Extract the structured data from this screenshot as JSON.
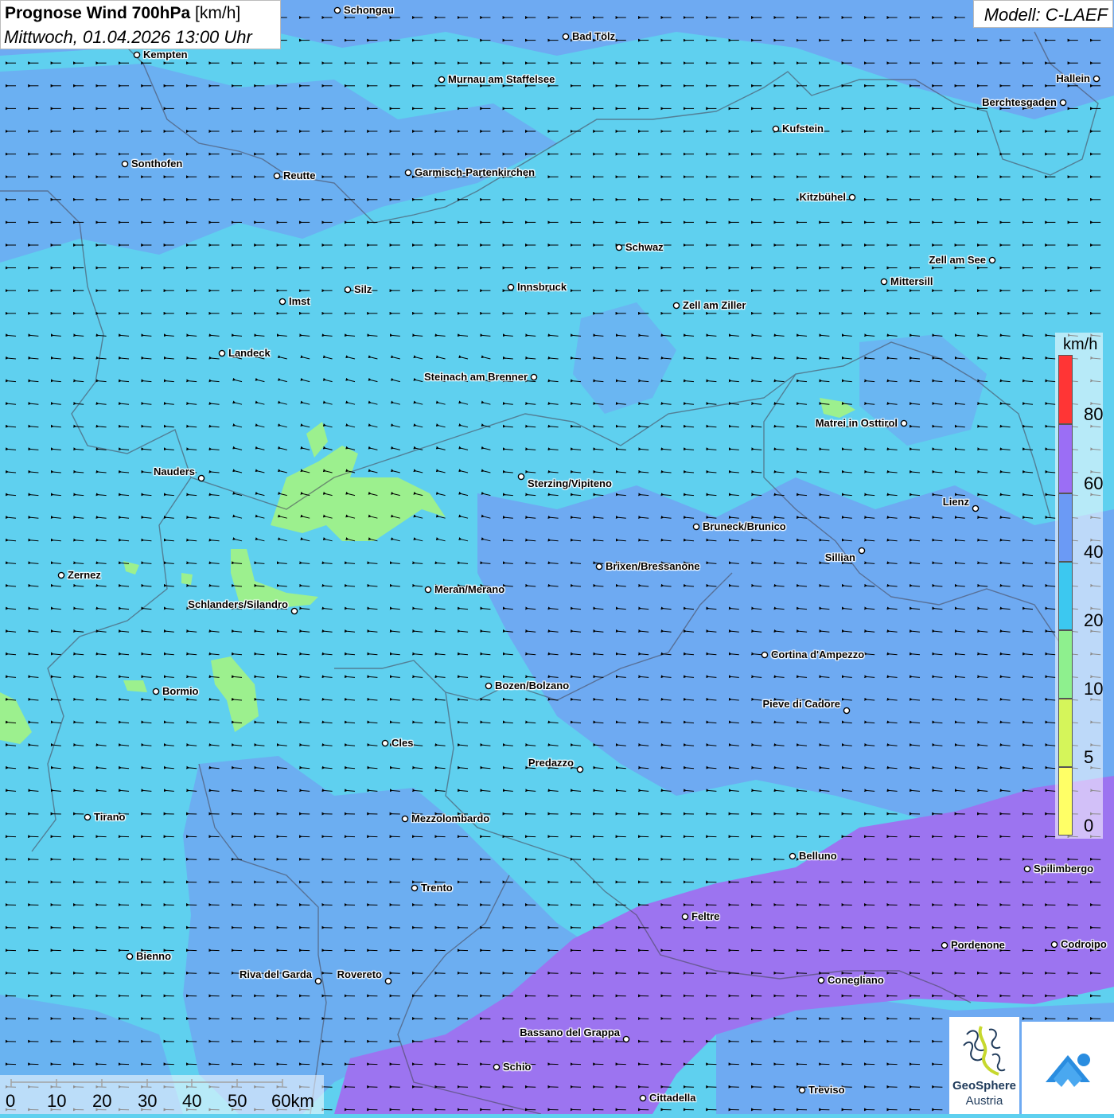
{
  "title": {
    "main": "Prognose Wind 700hPa",
    "unit": "[km/h]",
    "datetime": "Mittwoch, 01.04.2026 13:00 Uhr"
  },
  "model": "Modell: C-LAEF",
  "legend": {
    "unit": "km/h",
    "labels": [
      "80",
      "60",
      "40",
      "20",
      "10",
      "5",
      "0"
    ],
    "colors": [
      "#ff3535",
      "#9b6ef5",
      "#6b9af5",
      "#3cc8f0",
      "#8ef08e",
      "#d5f55a",
      "#ffff66"
    ]
  },
  "scalebar": {
    "labels": [
      "0",
      "10",
      "20",
      "30",
      "40",
      "50",
      "60km"
    ]
  },
  "cities": [
    {
      "name": "Schongau"
    },
    {
      "name": "Bad Tölz"
    },
    {
      "name": "Kempten"
    },
    {
      "name": "Murnau am Staffelsee"
    },
    {
      "name": "Hallein"
    },
    {
      "name": "Berchtesgaden"
    },
    {
      "name": "Kufstein"
    },
    {
      "name": "Sonthofen"
    },
    {
      "name": "Reutte"
    },
    {
      "name": "Garmisch-Partenkirchen"
    },
    {
      "name": "Kitzbühel"
    },
    {
      "name": "Schwaz"
    },
    {
      "name": "Zell am See"
    },
    {
      "name": "Mittersill"
    },
    {
      "name": "Silz"
    },
    {
      "name": "Innsbruck"
    },
    {
      "name": "Imst"
    },
    {
      "name": "Zell am Ziller"
    },
    {
      "name": "Landeck"
    },
    {
      "name": "Steinach am Brenner"
    },
    {
      "name": "Matrei in Osttirol"
    },
    {
      "name": "Nauders"
    },
    {
      "name": "Sterzing/Vipiteno"
    },
    {
      "name": "Lienz"
    },
    {
      "name": "Bruneck/Brunico"
    },
    {
      "name": "Sillian"
    },
    {
      "name": "Zernez"
    },
    {
      "name": "Brixen/Bressanone"
    },
    {
      "name": "Meran/Merano"
    },
    {
      "name": "Schlanders/Silandro"
    },
    {
      "name": "Cortina d'Ampezzo"
    },
    {
      "name": "Bozen/Bolzano"
    },
    {
      "name": "Bormio"
    },
    {
      "name": "Pieve di Cadore"
    },
    {
      "name": "Cles"
    },
    {
      "name": "Predazzo"
    },
    {
      "name": "Tirano"
    },
    {
      "name": "Mezzolombardo"
    },
    {
      "name": "Belluno"
    },
    {
      "name": "Spilimbergo"
    },
    {
      "name": "Trento"
    },
    {
      "name": "Feltre"
    },
    {
      "name": "Bienno"
    },
    {
      "name": "Pordenone"
    },
    {
      "name": "Codroipo"
    },
    {
      "name": "Riva del Garda"
    },
    {
      "name": "Rovereto"
    },
    {
      "name": "Conegliano"
    },
    {
      "name": "Bassano del Grappa"
    },
    {
      "name": "Schio"
    },
    {
      "name": "Treviso"
    },
    {
      "name": "Cittadella"
    }
  ],
  "logos": {
    "geosphere_line1": "GeoSphere",
    "geosphere_line2": "Austria"
  }
}
